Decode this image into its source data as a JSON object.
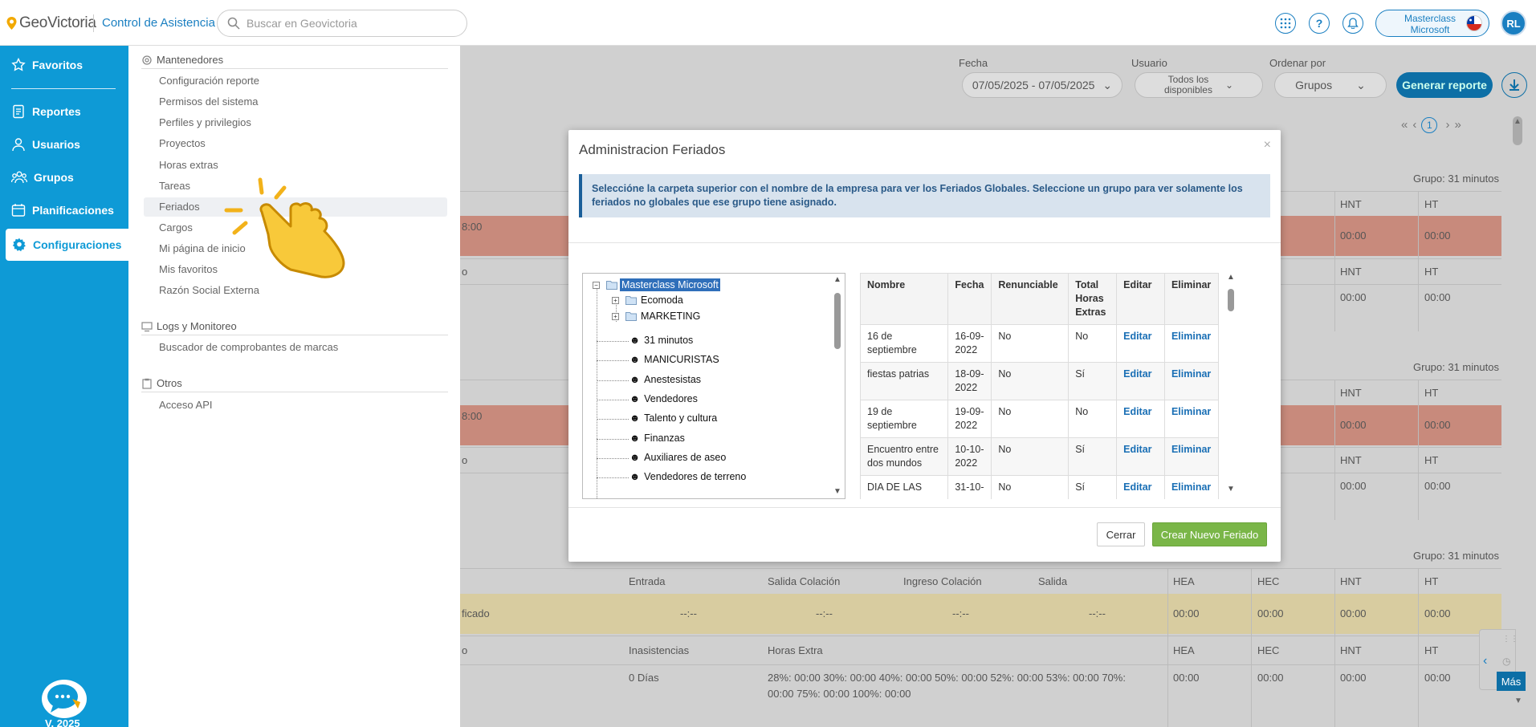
{
  "topbar": {
    "logo_text": "GeoVictoria",
    "app_name": "Control de Asistencia",
    "search_placeholder": "Buscar en Geovictoria",
    "company_line1": "Masterclass",
    "company_line2": "Microsoft",
    "avatar_initials": "RL",
    "icons": [
      "apps-icon",
      "help-icon",
      "bell-icon"
    ]
  },
  "leftnav": {
    "items": [
      {
        "label": "Favoritos",
        "icon": "star-icon"
      },
      {
        "label": "Reportes",
        "icon": "report-icon"
      },
      {
        "label": "Usuarios",
        "icon": "user-icon"
      },
      {
        "label": "Grupos",
        "icon": "groups-icon"
      },
      {
        "label": "Planificaciones",
        "icon": "calendar-icon"
      },
      {
        "label": "Configuraciones",
        "icon": "gear-icon"
      }
    ],
    "version": "V. 2025"
  },
  "submenu": {
    "sections": [
      {
        "title": "Mantenedores",
        "items": [
          "Configuración reporte",
          "Permisos del sistema",
          "Perfiles y privilegios",
          "Proyectos",
          "Horas extras",
          "Tareas",
          "Feriados",
          "Cargos",
          "Mi página de inicio",
          "Mis favoritos",
          "Razón Social Externa"
        ]
      },
      {
        "title": "Logs y Monitoreo",
        "items": [
          "Buscador de comprobantes de marcas"
        ]
      },
      {
        "title": "Otros",
        "items": [
          "Acceso API"
        ]
      }
    ]
  },
  "filters": {
    "fecha_label": "Fecha",
    "fecha_value": "07/05/2025 - 07/05/2025",
    "usuario_label": "Usuario",
    "usuario_value_1": "Todos los",
    "usuario_value_2": "disponibles",
    "orden_label": "Ordenar por",
    "orden_value": "Grupos",
    "generar_label": "Generar reporte",
    "page_current": "1"
  },
  "background": {
    "group_label": "Grupo: 31 minutos",
    "col_hnt": "HNT",
    "col_ht": "HT",
    "col_hea": "HEA",
    "col_hec": "HEC",
    "time_zero": "00:00",
    "partial_time": "8:00",
    "partial_o": "o",
    "partial_ficado": "ficado",
    "col_entrada": "Entrada",
    "col_salida_colacion": "Salida Colación",
    "col_ingreso_colacion": "Ingreso Colación",
    "col_salida": "Salida",
    "dash": "--:--",
    "col_inasistencias": "Inasistencias",
    "col_horas_extra": "Horas Extra",
    "inasistencias_value": "0 Días",
    "horas_extra_line1": "28%: 00:00 30%: 00:00 40%: 00:00 50%: 00:00 52%: 00:00 53%: 00:00 70%:",
    "horas_extra_line2": "00:00 75%: 00:00 100%: 00:00",
    "mas_label": "Más"
  },
  "modal": {
    "title": "Administracion Feriados",
    "info_line1": "Seleccióne la carpeta superior con el nombre de la empresa para ver los Feriados Globales. Seleccione un grupo para ver solamente los",
    "info_line2": "feriados no globales que ese grupo tiene asignado.",
    "tree": {
      "root": "Masterclass Microsoft",
      "folders": [
        "Ecomoda",
        "MARKETING"
      ],
      "groups": [
        "31 minutos",
        "MANICURISTAS",
        "Anestesistas",
        "Vendedores",
        "Talento y cultura",
        "Finanzas",
        "Auxiliares de aseo",
        "Vendedores de terreno"
      ]
    },
    "table": {
      "headers": [
        "Nombre",
        "Fecha",
        "Renunciable",
        "Total Horas Extras",
        "Editar",
        "Eliminar"
      ],
      "rows": [
        {
          "nombre": "16 de septiembre",
          "fecha": "16-09-2022",
          "renunciable": "No",
          "total": "No",
          "editar": "Editar",
          "eliminar": "Eliminar"
        },
        {
          "nombre": "fiestas patrias",
          "fecha": "18-09-2022",
          "renunciable": "No",
          "total": "Sí",
          "editar": "Editar",
          "eliminar": "Eliminar"
        },
        {
          "nombre": "19 de septiembre",
          "fecha": "19-09-2022",
          "renunciable": "No",
          "total": "No",
          "editar": "Editar",
          "eliminar": "Eliminar"
        },
        {
          "nombre": "Encuentro entre dos mundos",
          "fecha": "10-10-2022",
          "renunciable": "No",
          "total": "Sí",
          "editar": "Editar",
          "eliminar": "Eliminar"
        },
        {
          "nombre": "DIA DE LAS",
          "fecha": "31-10-",
          "renunciable": "No",
          "total": "Sí",
          "editar": "Editar",
          "eliminar": "Eliminar"
        }
      ]
    },
    "btn_cerrar": "Cerrar",
    "btn_crear": "Crear Nuevo Feriado"
  },
  "colors": {
    "nav_blue": "#0e9ad6",
    "accent": "#1a7fc1",
    "green": "#7ab648"
  }
}
